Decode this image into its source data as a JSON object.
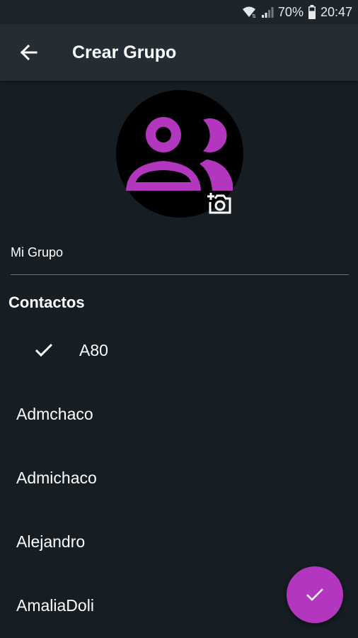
{
  "status_bar": {
    "battery_percent": "70%",
    "time": "20:47"
  },
  "app_bar": {
    "title": "Crear Grupo",
    "back_icon": "arrow-left-icon"
  },
  "avatar": {
    "icon": "group-icon",
    "camera_icon": "add-photo-icon",
    "icon_color": "#b336bf"
  },
  "group_name": {
    "value": "Mi Grupo"
  },
  "contacts": {
    "title": "Contactos",
    "items": [
      {
        "name": "A80",
        "selected": true
      },
      {
        "name": "Admchaco",
        "selected": false
      },
      {
        "name": "Admichaco",
        "selected": false
      },
      {
        "name": "Alejandro",
        "selected": false
      },
      {
        "name": "AmaliaDoli",
        "selected": false
      }
    ]
  },
  "fab": {
    "icon": "check-icon",
    "color": "#b336bf"
  }
}
